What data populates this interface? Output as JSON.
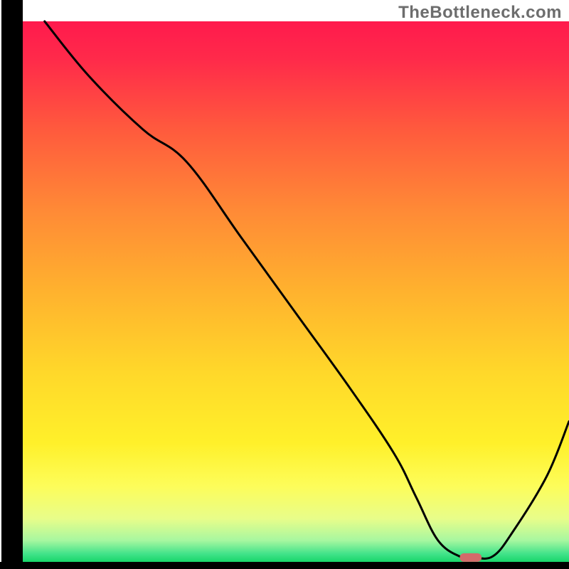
{
  "watermark": "TheBottleneck.com",
  "chart_data": {
    "type": "line",
    "title": "",
    "xlabel": "",
    "ylabel": "",
    "xlim": [
      0,
      100
    ],
    "ylim": [
      0,
      100
    ],
    "series": [
      {
        "name": "curve",
        "x": [
          4,
          12,
          22,
          30,
          40,
          50,
          60,
          68,
          72,
          76,
          80,
          82,
          86,
          90,
          96,
          100
        ],
        "values": [
          100,
          90,
          80,
          74,
          60,
          46,
          32,
          20,
          12,
          4,
          1,
          1,
          1,
          6,
          16,
          26
        ]
      }
    ],
    "marker": {
      "x_start": 80,
      "x_end": 84,
      "y": 0.8,
      "color": "#d46a6a"
    },
    "gradient_stops": [
      {
        "offset": 0.0,
        "color": "#ff1a4d"
      },
      {
        "offset": 0.07,
        "color": "#ff2a4a"
      },
      {
        "offset": 0.2,
        "color": "#ff5a3d"
      },
      {
        "offset": 0.35,
        "color": "#ff8a36"
      },
      {
        "offset": 0.5,
        "color": "#ffb22e"
      },
      {
        "offset": 0.65,
        "color": "#ffd82a"
      },
      {
        "offset": 0.78,
        "color": "#fff02a"
      },
      {
        "offset": 0.86,
        "color": "#fdfd5a"
      },
      {
        "offset": 0.92,
        "color": "#e8fd8a"
      },
      {
        "offset": 0.96,
        "color": "#a8f7a0"
      },
      {
        "offset": 0.985,
        "color": "#42e38a"
      },
      {
        "offset": 1.0,
        "color": "#18d66a"
      }
    ],
    "axis_color": "#000000",
    "curve_color": "#000000",
    "curve_width": 3
  }
}
